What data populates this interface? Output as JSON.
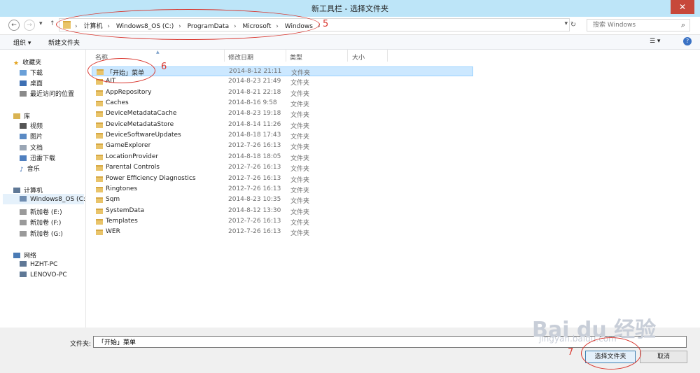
{
  "window": {
    "title": "新工具栏 - 选择文件夹",
    "close": "✕"
  },
  "nav": {
    "back": "←",
    "forward": "→",
    "dropdown": "▾",
    "up": "↑",
    "breadcrumbs": [
      "计算机",
      "Windows8_OS (C:)",
      "ProgramData",
      "Microsoft",
      "Windows"
    ],
    "separator": "›",
    "refresh": "↻",
    "search_placeholder": "搜索 Windows",
    "search_icon": "⌕"
  },
  "toolbar": {
    "organize": "组织 ▾",
    "new_folder": "新建文件夹",
    "view": "☰ ▾",
    "help": "?"
  },
  "sidebar": {
    "favorites": {
      "label": "收藏夹",
      "items": [
        "下载",
        "桌面",
        "最近访问的位置"
      ]
    },
    "libraries": {
      "label": "库",
      "items": [
        "视频",
        "图片",
        "文档",
        "迅雷下载",
        "音乐"
      ]
    },
    "computer": {
      "label": "计算机",
      "items": [
        "Windows8_OS (C:)",
        "新加卷 (E:)",
        "新加卷 (F:)",
        "新加卷 (G:)"
      ]
    },
    "network": {
      "label": "网络",
      "items": [
        "HZHT-PC",
        "LENOVO-PC"
      ]
    }
  },
  "columns": {
    "name": "名称",
    "modified": "修改日期",
    "type": "类型",
    "size": "大小"
  },
  "rows": [
    {
      "name": "「开始」菜单",
      "date": "2014-8-12 21:11",
      "type": "文件夹"
    },
    {
      "name": "AIT",
      "date": "2014-8-23 21:49",
      "type": "文件夹"
    },
    {
      "name": "AppRepository",
      "date": "2014-8-21 22:18",
      "type": "文件夹"
    },
    {
      "name": "Caches",
      "date": "2014-8-16 9:58",
      "type": "文件夹"
    },
    {
      "name": "DeviceMetadataCache",
      "date": "2014-8-23 19:18",
      "type": "文件夹"
    },
    {
      "name": "DeviceMetadataStore",
      "date": "2014-8-14 11:26",
      "type": "文件夹"
    },
    {
      "name": "DeviceSoftwareUpdates",
      "date": "2014-8-18 17:43",
      "type": "文件夹"
    },
    {
      "name": "GameExplorer",
      "date": "2012-7-26 16:13",
      "type": "文件夹"
    },
    {
      "name": "LocationProvider",
      "date": "2014-8-18 18:05",
      "type": "文件夹"
    },
    {
      "name": "Parental Controls",
      "date": "2012-7-26 16:13",
      "type": "文件夹"
    },
    {
      "name": "Power Efficiency Diagnostics",
      "date": "2012-7-26 16:13",
      "type": "文件夹"
    },
    {
      "name": "Ringtones",
      "date": "2012-7-26 16:13",
      "type": "文件夹"
    },
    {
      "name": "Sqm",
      "date": "2014-8-23 10:35",
      "type": "文件夹"
    },
    {
      "name": "SystemData",
      "date": "2014-8-12 13:30",
      "type": "文件夹"
    },
    {
      "name": "Templates",
      "date": "2012-7-26 16:13",
      "type": "文件夹"
    },
    {
      "name": "WER",
      "date": "2012-7-26 16:13",
      "type": "文件夹"
    }
  ],
  "footer": {
    "folder_label": "文件夹:",
    "folder_value": "「开始」菜单",
    "select": "选择文件夹",
    "cancel": "取消"
  },
  "annotations": {
    "n5": "5",
    "n6": "6",
    "n7": "7"
  },
  "watermark": {
    "brand": "Bai du 经验",
    "url": "jingyan.baidu.com"
  },
  "colors": {
    "selection": "#cce8ff",
    "annotation": "#d9362e",
    "titlebar": "#bde5f8"
  }
}
